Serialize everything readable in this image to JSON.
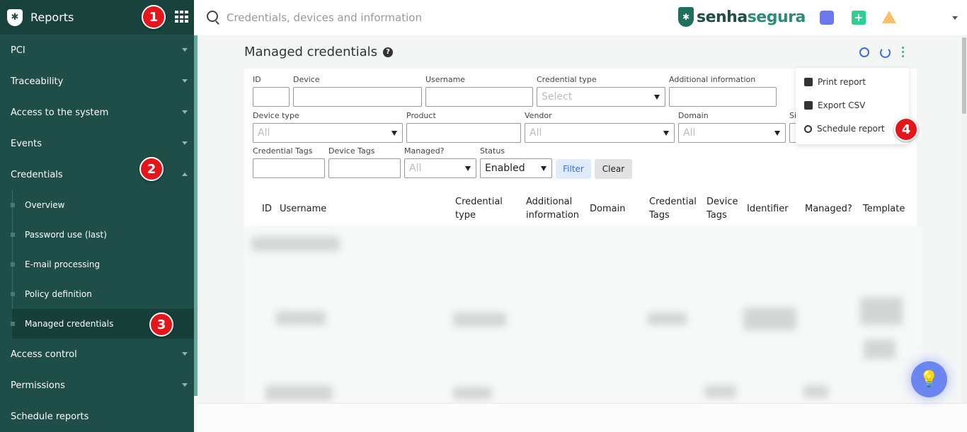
{
  "sidebar": {
    "title": "Reports",
    "logo_glyph": "✱",
    "items": [
      {
        "label": "PCI",
        "caret": "down"
      },
      {
        "label": "Traceability",
        "caret": "down"
      },
      {
        "label": "Access to the system",
        "caret": "down"
      },
      {
        "label": "Events",
        "caret": "down"
      },
      {
        "label": "Credentials",
        "caret": "up",
        "expanded": true
      }
    ],
    "subitems": [
      {
        "label": "Overview"
      },
      {
        "label": "Password use (last)"
      },
      {
        "label": "E-mail processing"
      },
      {
        "label": "Policy definition"
      },
      {
        "label": "Managed credentials",
        "active": true
      }
    ],
    "items_after": [
      {
        "label": "Access control",
        "caret": "down"
      },
      {
        "label": "Permissions",
        "caret": "down"
      },
      {
        "label": "Schedule reports"
      }
    ]
  },
  "badges": [
    "1",
    "2",
    "3",
    "4"
  ],
  "topbar": {
    "search_placeholder": "Credentials, devices and information",
    "brand_part1": "senha",
    "brand_part2": "segura",
    "brand_glyph": "✱",
    "plus_glyph": "+"
  },
  "page": {
    "title": "Managed credentials",
    "help_glyph": "?"
  },
  "filters": {
    "id_label": "ID",
    "device_label": "Device",
    "username_label": "Username",
    "credential_type_label": "Credential type",
    "credential_type_value": "Select",
    "additional_info_label": "Additional information",
    "device_type_label": "Device type",
    "device_type_value": "All",
    "product_label": "Product",
    "vendor_label": "Vendor",
    "vendor_value": "All",
    "domain_label": "Domain",
    "domain_value": "All",
    "si_label": "Si",
    "credential_tags_label": "Credential Tags",
    "device_tags_label": "Device Tags",
    "managed_label": "Managed?",
    "managed_value": "All",
    "status_label": "Status",
    "status_value": "Enabled",
    "filter_button": "Filter",
    "clear_button": "Clear"
  },
  "table": {
    "headers": [
      "ID",
      "Username",
      "Credential type",
      "Additional information",
      "Domain",
      "Credential Tags",
      "Device Tags",
      "Identifier",
      "Managed?",
      "Template"
    ]
  },
  "dropdown": {
    "items": [
      "Print report",
      "Export CSV",
      "Schedule report"
    ]
  },
  "colors": {
    "sidebar_bg": "#1f4d47",
    "accent_blue": "#3a6de0",
    "badge_red": "#e4151b",
    "brand_green": "#2c8c79"
  }
}
